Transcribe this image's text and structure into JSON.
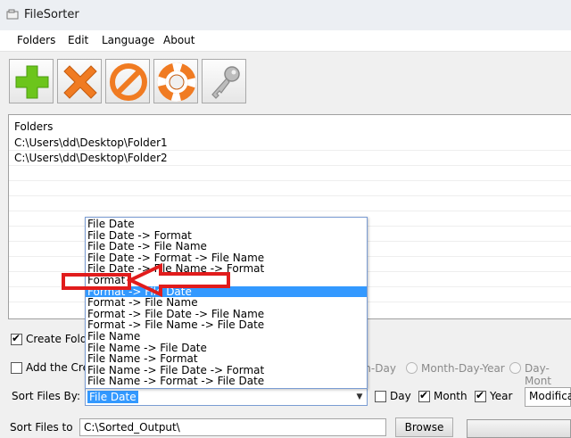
{
  "app": {
    "title": "FileSorter"
  },
  "menu": [
    "Folders",
    "Edit",
    "Language",
    "About"
  ],
  "toolbar": {
    "buttons": [
      {
        "name": "add-folder-button",
        "icon": "plus-icon",
        "color": "#6cc51c"
      },
      {
        "name": "remove-folder-button",
        "icon": "x-icon",
        "color": "#f07b22"
      },
      {
        "name": "cancel-button",
        "icon": "prohibit-icon",
        "color": "#f07b22"
      },
      {
        "name": "help-button",
        "icon": "lifebuoy-icon",
        "color": "#f07b22"
      },
      {
        "name": "key-button",
        "icon": "key-icon",
        "color": "#9a9a9a"
      }
    ]
  },
  "folders": {
    "header": "Folders",
    "items": [
      "C:\\Users\\dd\\Desktop\\Folder1",
      "C:\\Users\\dd\\Desktop\\Folder2"
    ]
  },
  "options": {
    "create_folders_label": "Create Fold",
    "add_label": "Add the Cre",
    "date_formats": [
      "nth-Day",
      "Month-Day-Year",
      "Day-Mont"
    ],
    "sort_by_label": "Sort Files By:",
    "sort_by_value": "File Date",
    "day_label": "Day",
    "month_label": "Month",
    "year_label": "Year",
    "modification_value": "Modificat",
    "sort_to_label": "Sort Files to",
    "sort_to_value": "C:\\Sorted_Output\\",
    "browse_label": "Browse"
  },
  "dropdown": {
    "options": [
      "File Date",
      "File Date -> Format",
      "File Date -> File Name",
      "File Date -> Format -> File Name",
      "File Date -> File Name -> Format",
      "Format",
      "Format -> File Date",
      "Format -> File Name",
      "Format -> File Date -> File Name",
      "Format -> File Name -> File Date",
      "File Name",
      "File Name -> File Date",
      "File Name -> Format",
      "File Name -> File Date -> Format",
      "File Name -> Format -> File Date"
    ],
    "selected_index": 6,
    "highlighted_index": 5
  },
  "colors": {
    "accent": "#3399ff",
    "annotation": "#e11c1c"
  }
}
